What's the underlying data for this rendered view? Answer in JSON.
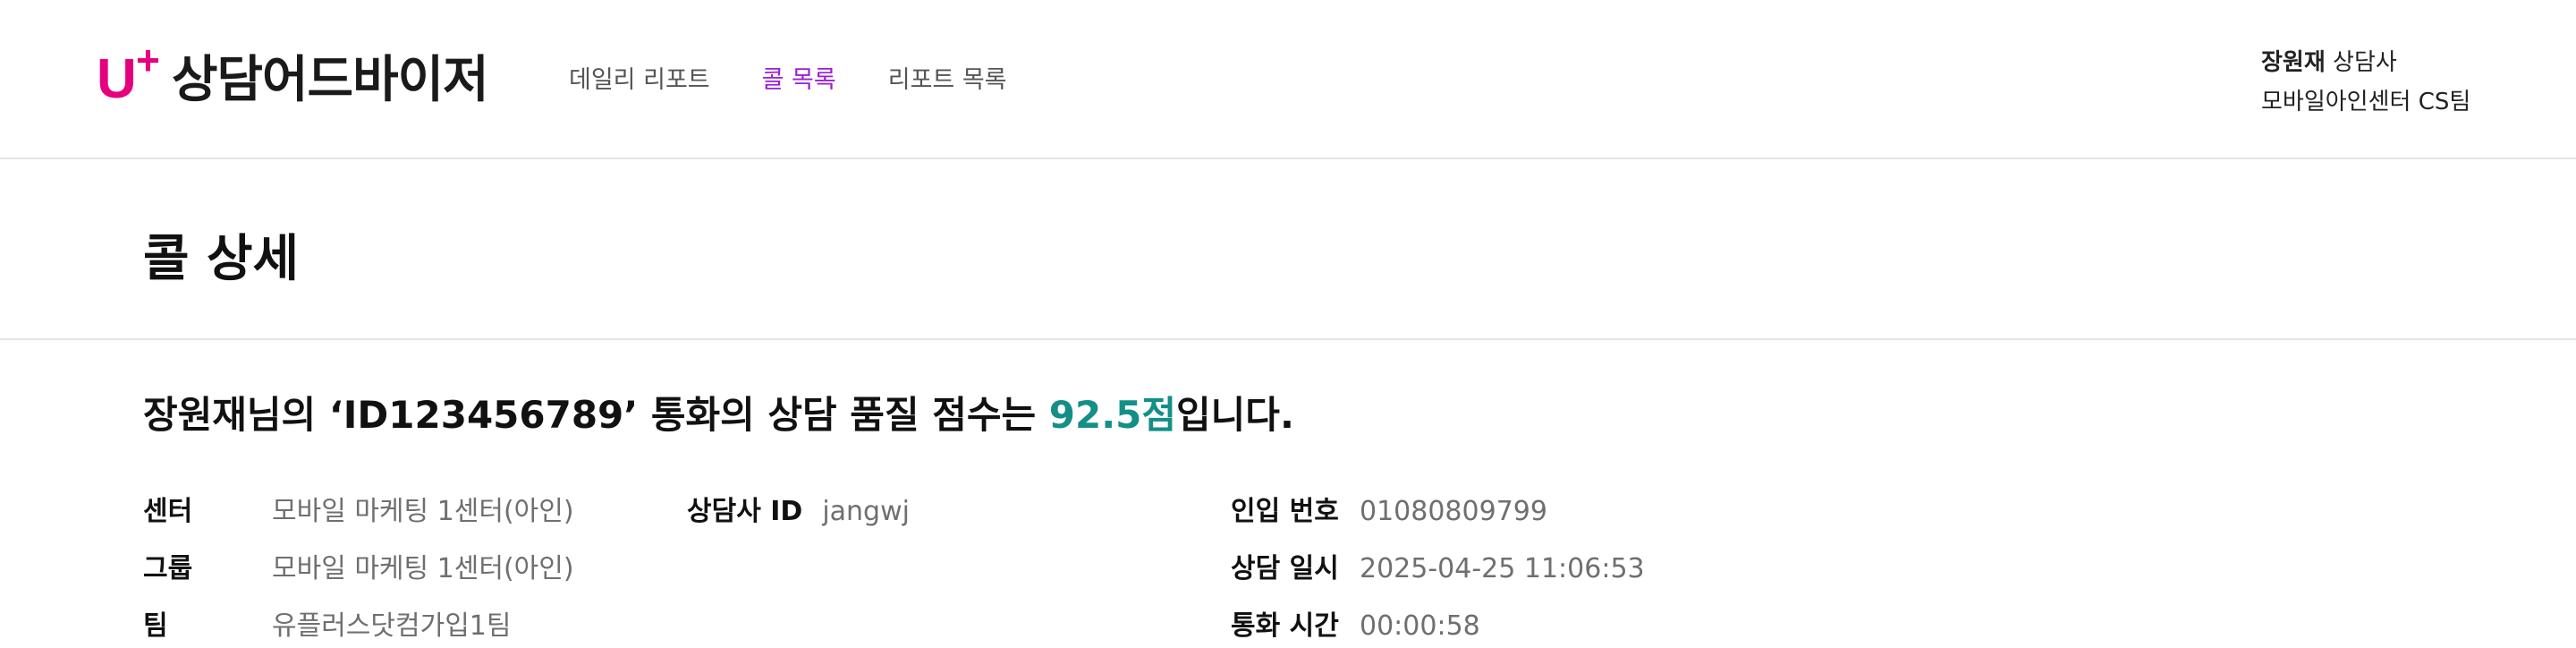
{
  "brand": {
    "mark_letter": "U",
    "mark_plus": "+",
    "name": "상담어드바이저",
    "color": "#e6007e"
  },
  "nav": {
    "items": [
      {
        "label": "데일리 리포트",
        "active": false
      },
      {
        "label": "콜 목록",
        "active": true
      },
      {
        "label": "리포트 목록",
        "active": false
      }
    ],
    "active_color": "#9b1fd6"
  },
  "user": {
    "name": "장원재",
    "role": "상담사",
    "team": "모바일아인센터 CS팀"
  },
  "page": {
    "title": "콜 상세"
  },
  "summary": {
    "prefix": "장원재님의 ‘ID123456789’ 통화의 상담 품질 점수는 ",
    "score": "92.5점",
    "suffix": "입니다.",
    "score_color": "#138f87"
  },
  "details": {
    "center": {
      "label": "센터",
      "value": "모바일 마케팅 1센터(아인)"
    },
    "group": {
      "label": "그룹",
      "value": "모바일 마케팅 1센터(아인)"
    },
    "team": {
      "label": "팀",
      "value": "유플러스닷컴가입1팀"
    },
    "agent_id": {
      "label": "상담사 ID",
      "value": "jangwj"
    },
    "inbound_number": {
      "label": "인입 번호",
      "value": "01080809799"
    },
    "consult_datetime": {
      "label": "상담 일시",
      "value": "2025-04-25 11:06:53"
    },
    "call_duration": {
      "label": "통화 시간",
      "value": "00:00:58"
    }
  }
}
